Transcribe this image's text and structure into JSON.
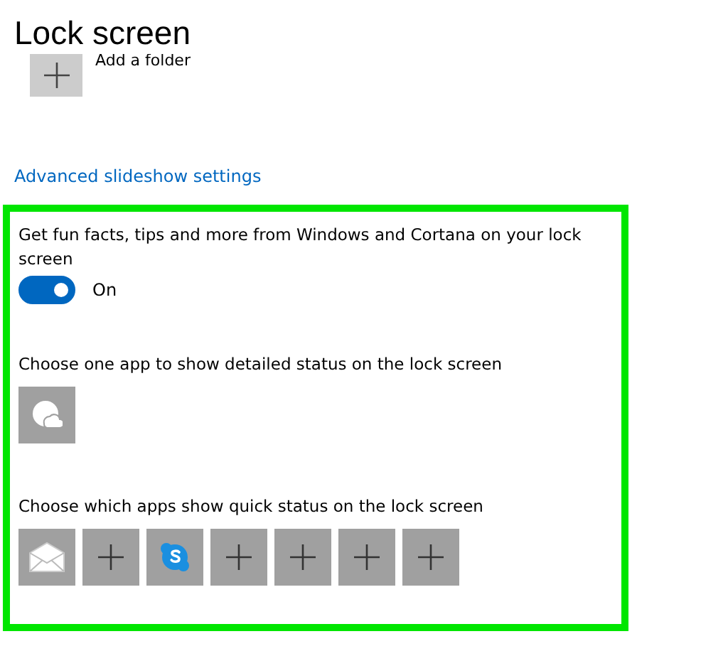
{
  "page": {
    "title": "Lock screen"
  },
  "folder": {
    "label": "Add a folder"
  },
  "link": "Advanced slideshow settings",
  "fun_facts": {
    "label": "Get fun facts, tips and more from Windows and Cortana on your lock screen",
    "on": true,
    "state_label": "On"
  },
  "detailed_status": {
    "label": "Choose one app to show detailed status on the lock screen",
    "app": {
      "kind": "weather"
    }
  },
  "quick_status": {
    "label": "Choose which apps show quick status on the lock screen",
    "apps": [
      {
        "kind": "mail"
      },
      {
        "kind": "add"
      },
      {
        "kind": "skype"
      },
      {
        "kind": "add"
      },
      {
        "kind": "add"
      },
      {
        "kind": "add"
      },
      {
        "kind": "add"
      }
    ]
  }
}
